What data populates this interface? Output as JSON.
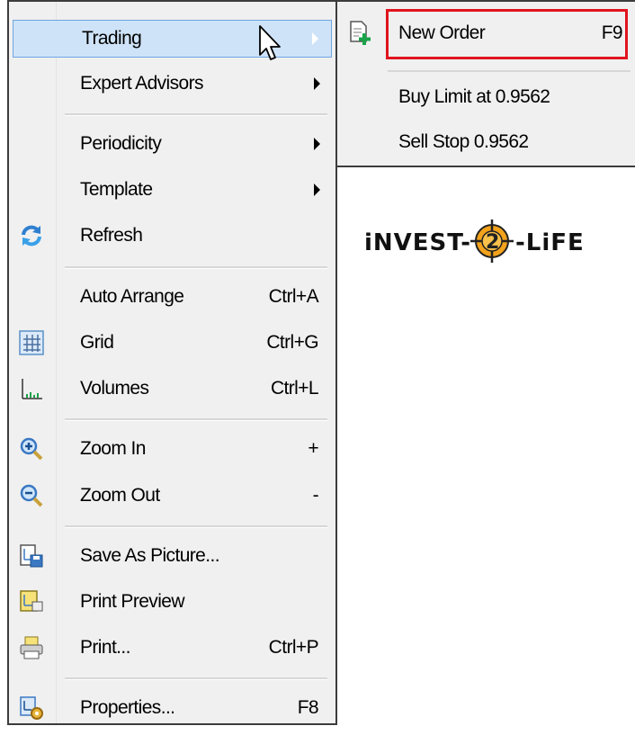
{
  "context_menu": {
    "items": [
      {
        "label": "Trading",
        "shortcut": "",
        "submenu": true
      },
      {
        "label": "Expert Advisors",
        "shortcut": "",
        "submenu": true
      },
      {
        "label": "Periodicity",
        "shortcut": "",
        "submenu": true
      },
      {
        "label": "Template",
        "shortcut": "",
        "submenu": true
      },
      {
        "label": "Refresh",
        "shortcut": "",
        "icon": "refresh-icon"
      },
      {
        "label": "Auto Arrange",
        "shortcut": "Ctrl+A"
      },
      {
        "label": "Grid",
        "shortcut": "Ctrl+G",
        "icon": "grid-icon"
      },
      {
        "label": "Volumes",
        "shortcut": "Ctrl+L",
        "icon": "volumes-icon"
      },
      {
        "label": "Zoom In",
        "shortcut": "+",
        "icon": "zoom-in-icon"
      },
      {
        "label": "Zoom Out",
        "shortcut": "-",
        "icon": "zoom-out-icon"
      },
      {
        "label": "Save As Picture...",
        "shortcut": "",
        "icon": "save-picture-icon"
      },
      {
        "label": "Print Preview",
        "shortcut": "",
        "icon": "print-preview-icon"
      },
      {
        "label": "Print...",
        "shortcut": "Ctrl+P",
        "icon": "printer-icon"
      },
      {
        "label": "Properties...",
        "shortcut": "F8",
        "icon": "properties-icon"
      }
    ]
  },
  "trading_submenu": {
    "items": [
      {
        "label": "New Order",
        "shortcut": "F9",
        "icon": "new-order-icon"
      },
      {
        "label": "Buy Limit at 0.9562",
        "shortcut": ""
      },
      {
        "label": "Sell Stop 0.9562",
        "shortcut": ""
      }
    ]
  },
  "colors": {
    "menu_bg": "#f0f0f0",
    "highlight_bg": "#cfe3f8",
    "highlight_border": "#6ea6e0",
    "annotation_red": "#e0141e"
  },
  "logo": {
    "text": "iNVEST-2-LiFE"
  }
}
